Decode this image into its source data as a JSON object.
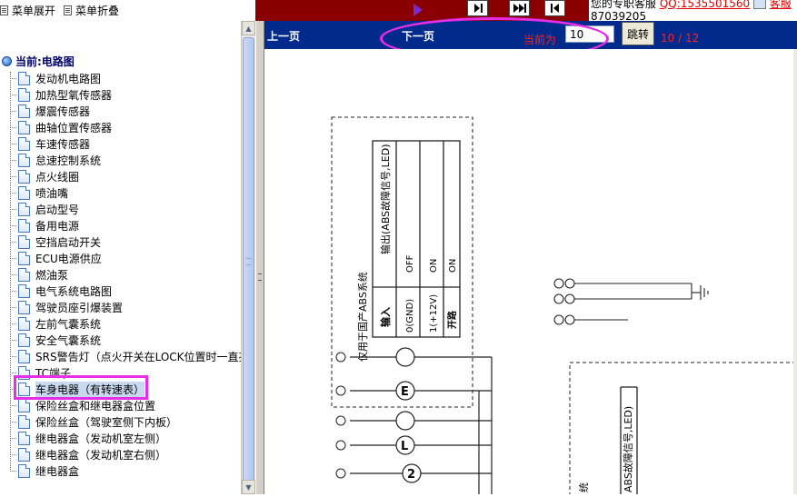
{
  "toolbar": {
    "expand_label": "菜单展开",
    "collapse_label": "菜单折叠"
  },
  "top_info": {
    "line1_text": "您的专职客服",
    "qq_text": "QQ:1535501560",
    "service_text": "客服",
    "phone_text": "87039205"
  },
  "nav": {
    "root_label": "当前:电路图",
    "items": [
      {
        "label": "发动机电路图"
      },
      {
        "label": "加热型氧传感器"
      },
      {
        "label": "爆震传感器"
      },
      {
        "label": "曲轴位置传感器"
      },
      {
        "label": "车速传感器"
      },
      {
        "label": "怠速控制系统"
      },
      {
        "label": "点火线圈"
      },
      {
        "label": "喷油嘴"
      },
      {
        "label": "启动型号"
      },
      {
        "label": "备用电源"
      },
      {
        "label": "空挡启动开关"
      },
      {
        "label": "ECU电源供应"
      },
      {
        "label": "燃油泵"
      },
      {
        "label": "电气系统电路图"
      },
      {
        "label": "驾驶员座引爆装置"
      },
      {
        "label": "左前气囊系统"
      },
      {
        "label": "安全气囊系统"
      },
      {
        "label": "SRS警告灯（点火开关在LOCK位置时一直亮"
      },
      {
        "label": "TC端子"
      },
      {
        "label": "车身电器（有转速表）"
      },
      {
        "label": "保险丝盒和继电器盒位置"
      },
      {
        "label": "保险丝盒（驾驶室侧下内板）"
      },
      {
        "label": "继电器盒（发动机室左侧）"
      },
      {
        "label": "继电器盒（发动机室右侧）"
      },
      {
        "label": "继电器盒"
      }
    ],
    "selected_index": 19
  },
  "pager": {
    "prev_label": "上一页",
    "next_label": "下一页",
    "current_label": "当前为",
    "page_value": "10",
    "jump_label": "跳转",
    "page_count": "10 / 12"
  },
  "diagram": {
    "box1_title": "仅用于国产ABS系统",
    "header_input": "输入",
    "header_output": "输出(ABS故障信号,LED)",
    "rows": [
      {
        "input": "0(GND)",
        "output": "OFF"
      },
      {
        "input": "1(+12V)",
        "output": "ON"
      },
      {
        "input": "开路",
        "output": "ON"
      }
    ],
    "box2_title": "ABS故障信号,LED)",
    "box2_tail": "统",
    "symbol_L": "L",
    "symbol_2": "2",
    "symbol_E": "E"
  },
  "colors": {
    "pager_bar": "#022a8c",
    "highlight": "#e62ee6",
    "top_strip": "#8a0000"
  }
}
